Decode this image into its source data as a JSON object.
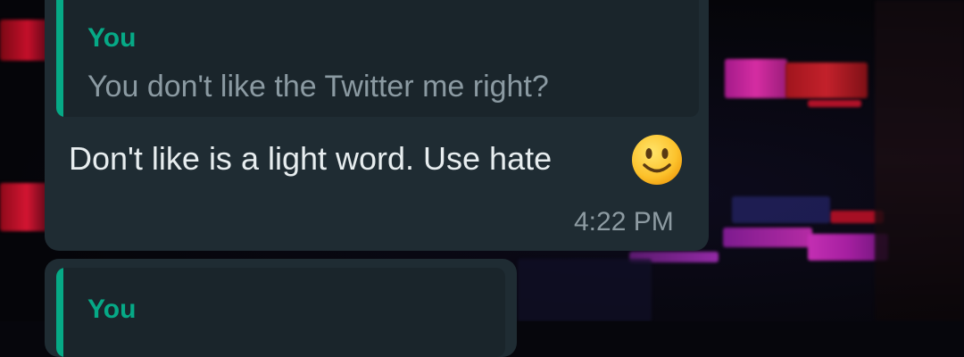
{
  "messages": [
    {
      "quote": {
        "author": "You",
        "text": "You don't like the Twitter me right?"
      },
      "text": "Don't like is a light word. Use hate",
      "emoji": "slightly-smiling-face-icon",
      "time": "4:22 PM"
    },
    {
      "quote": {
        "author": "You",
        "text": ""
      }
    }
  ],
  "colors": {
    "bubble": "#1f2c33",
    "quote_background": "#1a252b",
    "quote_accent": "#06a986",
    "message_text": "#e7edef",
    "secondary_text": "#8d9ba2"
  }
}
